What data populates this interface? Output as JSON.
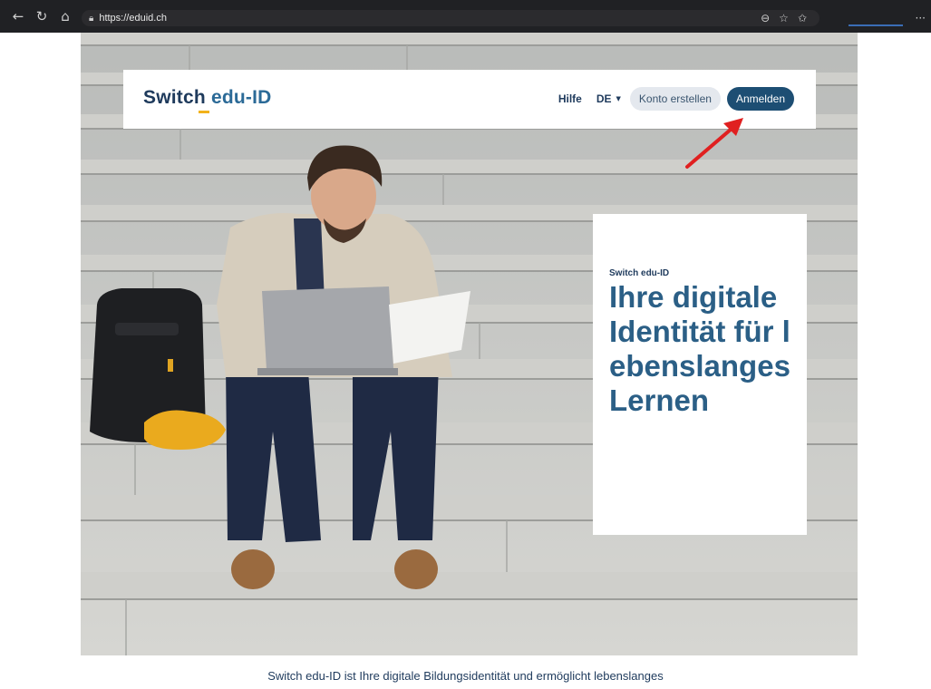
{
  "browser": {
    "url": "https://eduid.ch",
    "back_icon": "←",
    "reload_icon": "↻",
    "home_icon": "⌂",
    "menu_icon": "···"
  },
  "header": {
    "logo_switch": "Switch",
    "logo_edu": "edu-ID",
    "help": "Hilfe",
    "language": "DE",
    "register": "Konto erstellen",
    "login": "Anmelden"
  },
  "callout": {
    "kicker": "Switch edu-ID",
    "title": "Ihre digitale Identität für lebenslanges Lernen"
  },
  "intro": {
    "text": "Switch edu-ID ist Ihre digitale Bildungsidentität und ermöglicht lebenslanges"
  },
  "colors": {
    "brand_dark": "#1e3a5c",
    "brand_blue": "#2b6a97",
    "accent_yellow": "#f2b21a",
    "arrow_red": "#e02020"
  }
}
